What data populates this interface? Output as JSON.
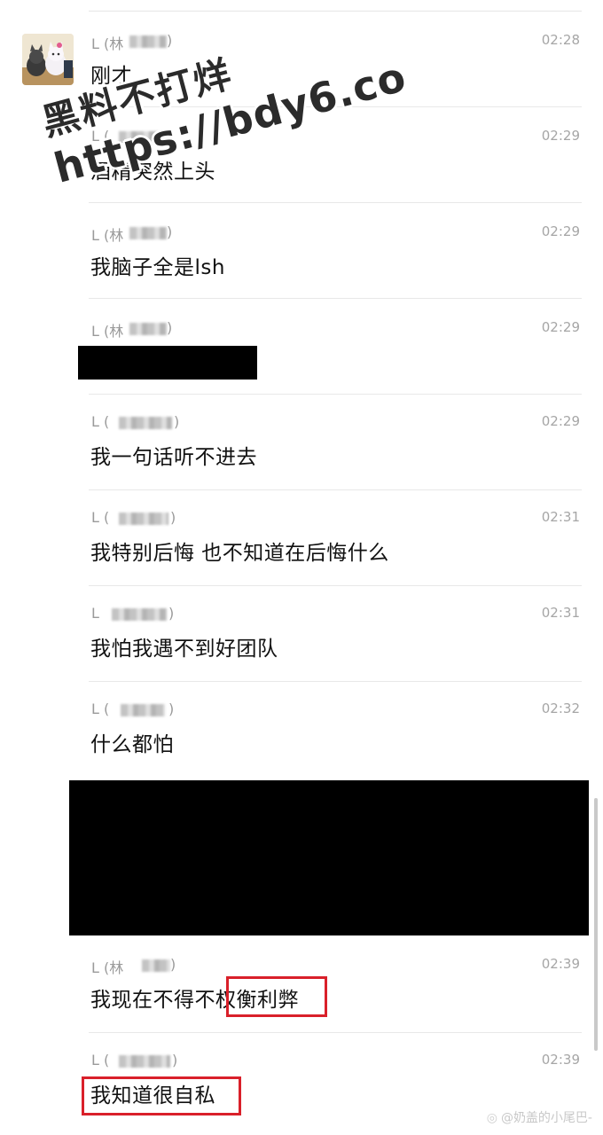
{
  "messages": [
    {
      "sender": "L (林",
      "time": "02:28",
      "text": "刚才"
    },
    {
      "sender": "L (",
      "time": "02:29",
      "text": "酒精突然上头"
    },
    {
      "sender": "L (林",
      "time": "02:29",
      "text": "我脑子全是lsh"
    },
    {
      "sender": "L (林",
      "time": "02:29",
      "text": ""
    },
    {
      "sender": "L (",
      "time": "02:29",
      "text": "我一句话听不进去"
    },
    {
      "sender": "L (",
      "time": "02:31",
      "text": "我特别后悔 也不知道在后悔什么"
    },
    {
      "sender": "L",
      "time": "02:31",
      "text": "我怕我遇不到好团队"
    },
    {
      "sender": "L (",
      "time": "02:32",
      "text": "什么都怕"
    },
    {
      "sender": "L (林",
      "time": "02:39",
      "text_a": "我现在不得不",
      "text_b": "权衡利弊"
    },
    {
      "sender": "L (",
      "time": "02:39",
      "text": "我知道很自私"
    }
  ],
  "watermark": {
    "line1": "黑料不打烊",
    "line2": "https://bdy6.co"
  },
  "credit": "@奶盖的小尾巴-",
  "colors": {
    "highlight": "#d9202a",
    "redaction": "#000000"
  }
}
